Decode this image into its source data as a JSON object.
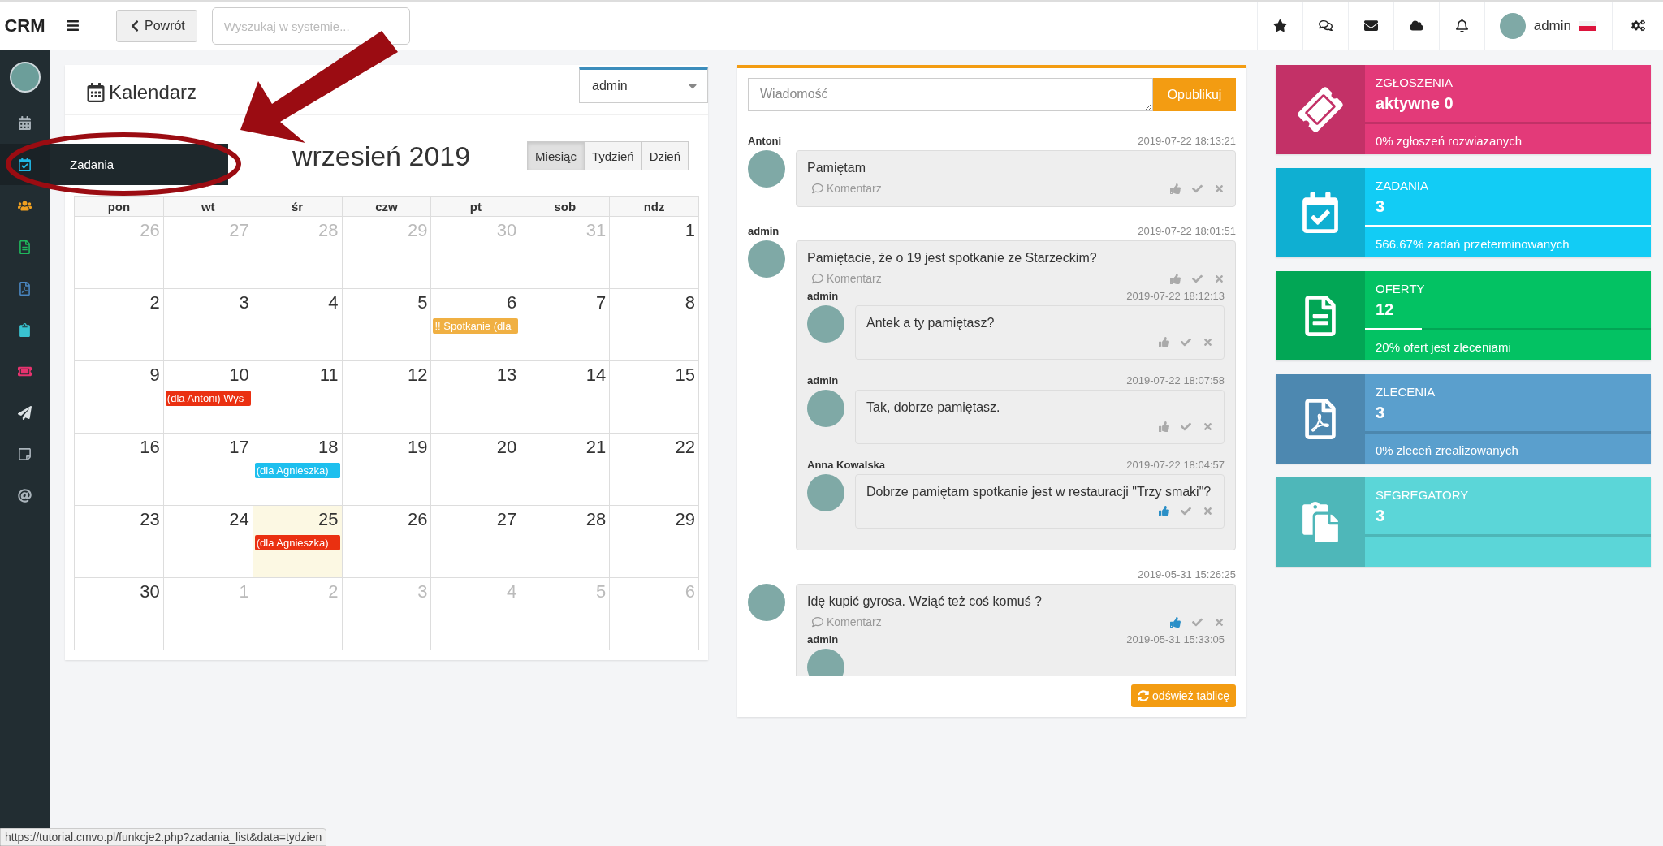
{
  "topbar": {
    "brand": "CRM",
    "back_button": "Powrót",
    "search": {
      "placeholder": "Wyszukaj w systemie..."
    },
    "icons": [
      {
        "kind": "favorites"
      },
      {
        "kind": "messages"
      },
      {
        "kind": "mail"
      },
      {
        "kind": "cloud"
      },
      {
        "kind": "notifications"
      }
    ],
    "user": {
      "name": "admin"
    }
  },
  "sidebar": {
    "items": [
      {
        "kind": "calendar",
        "color": "#aab4bb",
        "selected": false
      },
      {
        "kind": "tasks",
        "color": "#21b8e6",
        "selected": true,
        "tooltip": "Zadania"
      },
      {
        "kind": "contacts",
        "color": "#f0a020",
        "selected": false
      },
      {
        "kind": "offers",
        "color": "#1fb85c",
        "selected": false
      },
      {
        "kind": "orders",
        "color": "#4a86c0",
        "selected": false
      },
      {
        "kind": "binders",
        "color": "#39c2d0",
        "selected": false
      },
      {
        "kind": "tickets",
        "color": "#e8336f",
        "selected": false
      },
      {
        "kind": "send",
        "color": "#dde3e6",
        "selected": false
      },
      {
        "kind": "notes",
        "color": "#aab4bb",
        "selected": false
      },
      {
        "kind": "email",
        "color": "#aab4bb",
        "selected": false
      }
    ]
  },
  "calendar": {
    "title": "Kalendarz",
    "owner_select": "admin",
    "month_title": "wrzesień 2019",
    "views": [
      {
        "label": "Miesiąc",
        "selected": true
      },
      {
        "label": "Tydzień",
        "selected": false
      },
      {
        "label": "Dzień",
        "selected": false
      }
    ],
    "weekdays": [
      "pon",
      "wt",
      "śr",
      "czw",
      "pt",
      "sob",
      "ndz"
    ],
    "weeks": [
      [
        {
          "day": "26",
          "muted": true
        },
        {
          "day": "27",
          "muted": true
        },
        {
          "day": "28",
          "muted": true
        },
        {
          "day": "29",
          "muted": true
        },
        {
          "day": "30",
          "muted": true
        },
        {
          "day": "31",
          "muted": true
        },
        {
          "day": "1",
          "muted": false
        }
      ],
      [
        {
          "day": "2",
          "muted": false
        },
        {
          "day": "3",
          "muted": false
        },
        {
          "day": "4",
          "muted": false
        },
        {
          "day": "5",
          "muted": false
        },
        {
          "day": "6",
          "muted": false,
          "events": [
            {
              "label": "!! Spotkanie (dla",
              "color": "#f0b043"
            }
          ]
        },
        {
          "day": "7",
          "muted": false
        },
        {
          "day": "8",
          "muted": false
        }
      ],
      [
        {
          "day": "9",
          "muted": false
        },
        {
          "day": "10",
          "muted": false,
          "events": [
            {
              "label": "(dla Antoni) Wys",
              "color": "#ea3011"
            }
          ]
        },
        {
          "day": "11",
          "muted": false
        },
        {
          "day": "12",
          "muted": false
        },
        {
          "day": "13",
          "muted": false
        },
        {
          "day": "14",
          "muted": false
        },
        {
          "day": "15",
          "muted": false
        }
      ],
      [
        {
          "day": "16",
          "muted": false
        },
        {
          "day": "17",
          "muted": false
        },
        {
          "day": "18",
          "muted": false,
          "events": [
            {
              "label": "(dla Agnieszka)",
              "color": "#1dbfee"
            }
          ]
        },
        {
          "day": "19",
          "muted": false
        },
        {
          "day": "20",
          "muted": false
        },
        {
          "day": "21",
          "muted": false
        },
        {
          "day": "22",
          "muted": false
        }
      ],
      [
        {
          "day": "23",
          "muted": false
        },
        {
          "day": "24",
          "muted": false
        },
        {
          "day": "25",
          "muted": false,
          "today": true,
          "events": [
            {
              "label": "(dla Agnieszka)",
              "color": "#ea3011"
            }
          ]
        },
        {
          "day": "26",
          "muted": false
        },
        {
          "day": "27",
          "muted": false
        },
        {
          "day": "28",
          "muted": false
        },
        {
          "day": "29",
          "muted": false
        }
      ],
      [
        {
          "day": "30",
          "muted": false
        },
        {
          "day": "1",
          "muted": true
        },
        {
          "day": "2",
          "muted": true
        },
        {
          "day": "3",
          "muted": true
        },
        {
          "day": "4",
          "muted": true
        },
        {
          "day": "5",
          "muted": true
        },
        {
          "day": "6",
          "muted": true
        }
      ]
    ]
  },
  "feed": {
    "composer": {
      "placeholder": "Wiadomość",
      "publish_button": "Opublikuj"
    },
    "posts": [
      {
        "author": "Antoni",
        "time": "2019-07-22 18:13:21",
        "text": "Pamiętam",
        "comment_link": "Komentarz",
        "liked": false
      },
      {
        "author": "admin",
        "time": "2019-07-22 18:01:51",
        "text": "Pamiętacie, że o 19 jest spotkanie ze Starzeckim?",
        "comment_link": "Komentarz",
        "liked": false,
        "replies": [
          {
            "author": "admin",
            "time": "2019-07-22 18:12:13",
            "text": "Antek a ty pamiętasz?",
            "liked": false
          },
          {
            "author": "admin",
            "time": "2019-07-22 18:07:58",
            "text": "Tak, dobrze pamiętasz.",
            "liked": false
          },
          {
            "author": "Anna Kowalska",
            "time": "2019-07-22 18:04:57",
            "text": "Dobrze pamiętam spotkanie jest w restauracji \"Trzy smaki\"?",
            "liked": true
          }
        ]
      },
      {
        "time": "2019-05-31 15:26:25",
        "text": "Idę kupić gyrosa. Wziąć też coś komuś ?",
        "comment_link": "Komentarz",
        "liked": true,
        "replies": [
          {
            "author": "admin",
            "time": "2019-05-31 15:33:05"
          }
        ]
      }
    ],
    "refresh_button": "odśwież tablicę"
  },
  "stat_cards": [
    {
      "kind": "tickets",
      "title": "ZGŁOSZENIA",
      "count": "aktywne **0**",
      "level": 0,
      "subtitle": "0% zgłoszeń rozwiazanych",
      "color": "#e33a79"
    },
    {
      "kind": "tasks",
      "title": "ZADANIA",
      "count": "3",
      "level": 1,
      "subtitle": "566.67% zadań przeterminowanych",
      "color": "#12ccf5"
    },
    {
      "kind": "offers",
      "title": "OFERTY",
      "count": "12",
      "level": 0.2,
      "subtitle": "20% ofert jest zleceniami",
      "color": "#03c263"
    },
    {
      "kind": "orders",
      "title": "ZLECENIA",
      "count": "3",
      "level": 0,
      "subtitle": "0% zleceń zrealizowanych",
      "color": "#5a9fcd"
    },
    {
      "kind": "binders",
      "title": "SEGREGATORY",
      "count": "3",
      "level": 0
    }
  ],
  "status_url": "https://tutorial.cmvo.pl/funkcje2.php?zadania_list&data=tydzien"
}
